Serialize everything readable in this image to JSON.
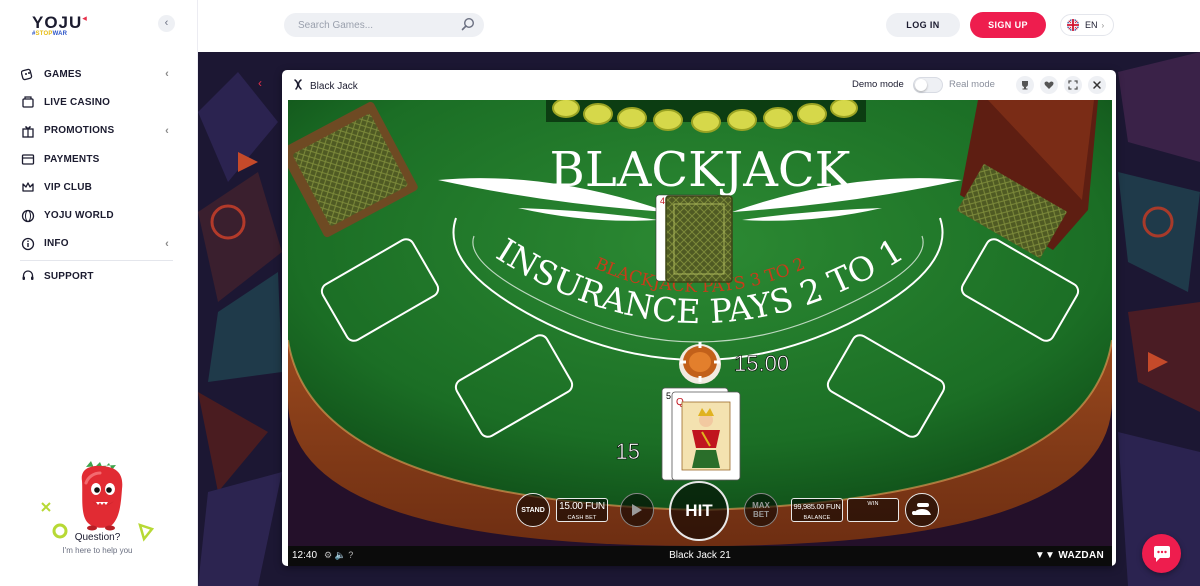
{
  "brand": {
    "logo": "YOJU",
    "tag_prefix": "#",
    "tag_a": "STOP",
    "tag_b": "WAR"
  },
  "sidebar": {
    "collapse_icon": "chevron-left-icon",
    "items": [
      {
        "label": "GAMES",
        "icon": "dice-icon",
        "expandable": true
      },
      {
        "label": "LIVE CASINO",
        "icon": "cards-icon",
        "expandable": false
      },
      {
        "label": "PROMOTIONS",
        "icon": "gift-icon",
        "expandable": true
      },
      {
        "label": "PAYMENTS",
        "icon": "wallet-icon",
        "expandable": false
      },
      {
        "label": "VIP CLUB",
        "icon": "crown-icon",
        "expandable": false
      },
      {
        "label": "YOJU WORLD",
        "icon": "globe-icon",
        "expandable": false
      },
      {
        "label": "INFO",
        "icon": "info-icon",
        "expandable": true
      }
    ],
    "support": {
      "label": "SUPPORT",
      "icon": "headset-icon"
    },
    "helper": {
      "question": "Question?",
      "subtitle": "I'm here to help you"
    }
  },
  "header": {
    "search_placeholder": "Search Games...",
    "login_label": "LOG IN",
    "signup_label": "SIGN UP",
    "language": "EN"
  },
  "game_window": {
    "title": "Black Jack",
    "demo_label": "Demo mode",
    "real_label": "Real mode",
    "demo_enabled": true
  },
  "game": {
    "table_title": "BLACKJACK",
    "insurance_text": "INSURANCE PAYS 2 TO 1",
    "blackjack_text": "BLACKJACK PAYS 3 TO 2",
    "bet_amount": "15.00",
    "player_total": "15",
    "dealer_upcard": "4",
    "player_cards": [
      "5",
      "Q"
    ],
    "hud": {
      "stand_label": "STAND",
      "cash_bet_value": "15.00 FUN",
      "cash_bet_label": "CASH BET",
      "hit_label": "HIT",
      "max_bet_label": "MAX BET",
      "balance_value": "99,985.00 FUN",
      "balance_label": "BALANCE",
      "win_value": "",
      "win_label": "WIN"
    },
    "status": {
      "time": "12:40",
      "game_name": "Black Jack 21",
      "provider": "WAZDAN"
    }
  },
  "colors": {
    "accent": "#ee1d4e",
    "felt": "#1f7a2a",
    "rail": "#a85420"
  }
}
